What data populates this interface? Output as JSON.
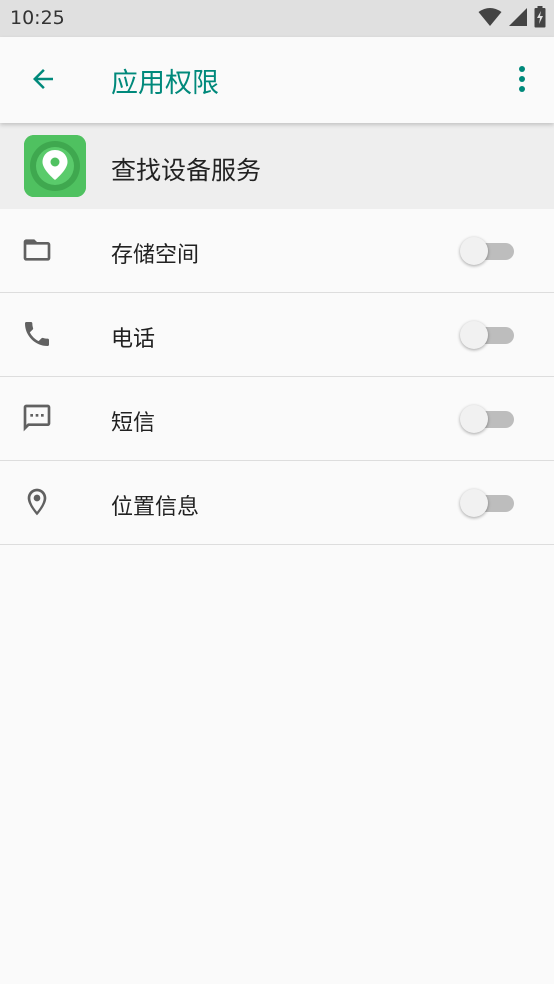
{
  "status_bar": {
    "time": "10:25",
    "icons": [
      "wifi-icon",
      "cell-signal-icon",
      "battery-charging-icon"
    ]
  },
  "toolbar": {
    "title": "应用权限",
    "back_icon": "arrow-back-icon",
    "more_icon": "more-vert-icon"
  },
  "app": {
    "name": "查找设备服务",
    "icon": "location-pin-app-icon"
  },
  "permissions": [
    {
      "label": "存储空间",
      "icon": "folder-icon",
      "enabled": false
    },
    {
      "label": "电话",
      "icon": "phone-icon",
      "enabled": false
    },
    {
      "label": "短信",
      "icon": "sms-icon",
      "enabled": false
    },
    {
      "label": "位置信息",
      "icon": "location-icon",
      "enabled": false
    }
  ],
  "colors": {
    "accent": "#00897b",
    "status_bar_bg": "#e0e0e0",
    "header_bg": "#eeeeee",
    "app_icon_green": "#4fc160",
    "switch_track_off": "#bdbdbd",
    "switch_thumb_off": "#f1f1f1",
    "icon_grey": "#616161"
  }
}
